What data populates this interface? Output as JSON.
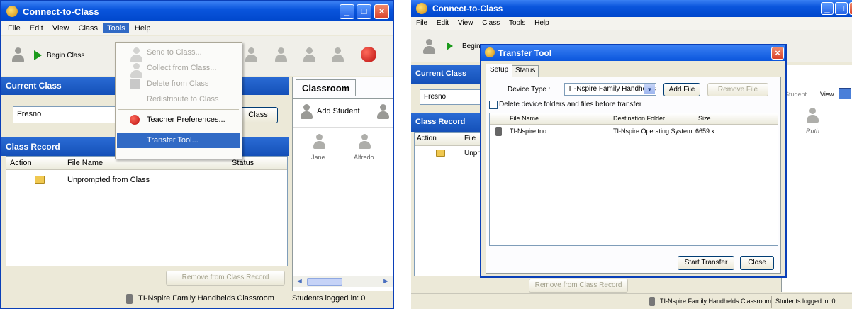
{
  "left_window": {
    "title": "Connect-to-Class",
    "menu": [
      "File",
      "Edit",
      "View",
      "Class",
      "Tools",
      "Help"
    ],
    "toolbar": {
      "begin_class": "Begin Class"
    },
    "tools_menu": [
      {
        "label": "Send to Class...",
        "enabled": false
      },
      {
        "label": "Collect from Class...",
        "enabled": false
      },
      {
        "label": "Delete from Class",
        "enabled": false
      },
      {
        "label": "Redistribute to Class",
        "enabled": false
      },
      {
        "label": "Teacher Preferences...",
        "enabled": true
      },
      {
        "label": "Transfer Tool...",
        "enabled": true,
        "highlighted": true
      }
    ],
    "current_class": {
      "header": "Current Class",
      "value": "Fresno",
      "button": "Class"
    },
    "class_record": {
      "header": "Class Record",
      "columns": [
        "Action",
        "File Name",
        "Status"
      ],
      "rows": [
        {
          "file": "Unprompted from Class"
        }
      ],
      "remove_button": "Remove from Class Record"
    },
    "classroom": {
      "tab": "Classroom",
      "add_student": "Add Student",
      "students": [
        "Jane",
        "Alfredo"
      ]
    },
    "status": {
      "classroom": "TI-Nspire Family Handhelds Classroom",
      "logged_in": "Students logged in:  0"
    }
  },
  "right_window": {
    "title": "Connect-to-Class",
    "menu": [
      "File",
      "Edit",
      "View",
      "Class",
      "Tools",
      "Help"
    ],
    "toolbar": {
      "begin_class": "Begin"
    },
    "current_class": {
      "header": "Current Class",
      "value": "Fresno"
    },
    "class_record": {
      "header": "Class Record",
      "columns": [
        "Action",
        "File"
      ],
      "rows": [
        {
          "file": "Unpro"
        }
      ],
      "remove_button": "Remove from Class Record"
    },
    "right_strip": {
      "student_label": "Student",
      "view_label": "View",
      "students": [
        "Ruth"
      ]
    },
    "status": {
      "classroom": "TI-Nspire Family Handhelds Classroom",
      "logged_in": "Students logged in: 0"
    },
    "dialog": {
      "title": "Transfer Tool",
      "tabs": [
        "Setup",
        "Status"
      ],
      "device_type_label": "Device Type :",
      "device_type_value": "TI-Nspire Family Handhelds",
      "add_file": "Add File",
      "remove_file": "Remove File",
      "delete_checkbox": "Delete device folders and files before transfer",
      "columns": [
        "File Name",
        "Destination Folder",
        "Size"
      ],
      "files": [
        {
          "name": "TI-Nspire.tno",
          "destination": "TI-Nspire Operating System",
          "size": "6659 k"
        }
      ],
      "start_transfer": "Start Transfer",
      "close": "Close"
    }
  },
  "colors": {
    "titlebar": "#0a55dc",
    "panel_header": "#1d5ec4",
    "highlight": "#316ac5",
    "window_bg": "#ece9d8"
  }
}
